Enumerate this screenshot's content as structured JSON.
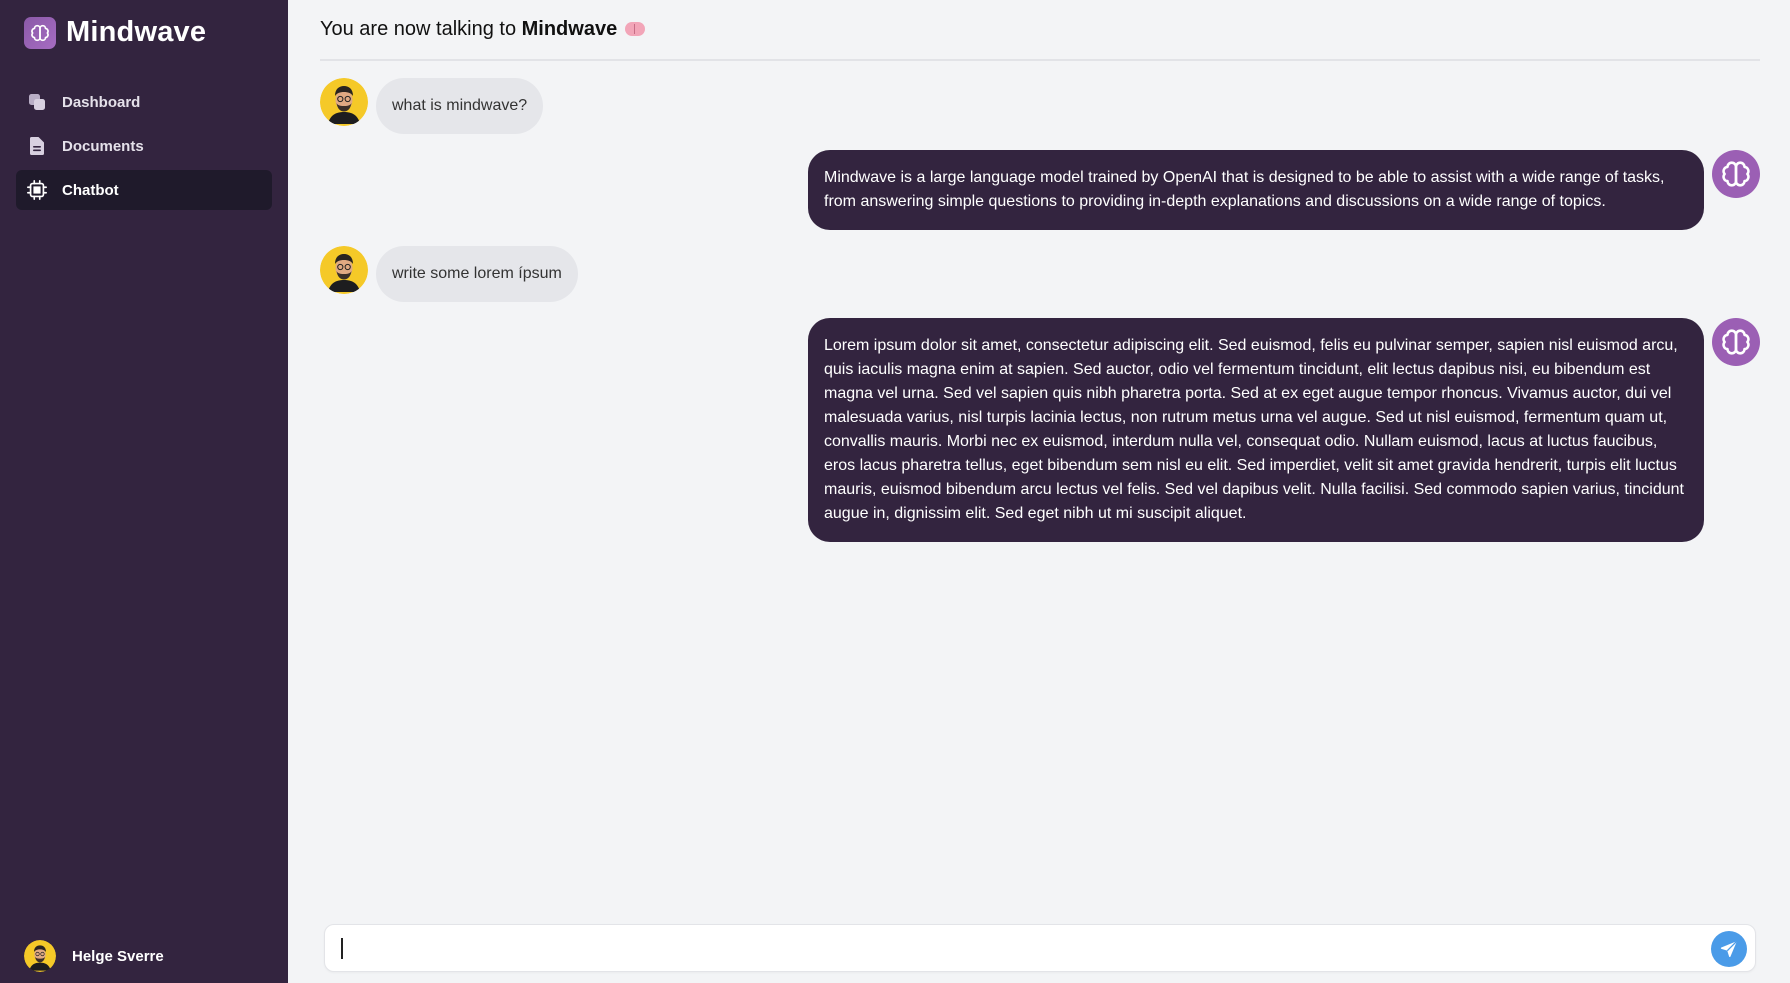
{
  "app": {
    "name": "Mindwave"
  },
  "sidebar": {
    "items": [
      {
        "label": "Dashboard",
        "icon": "dashboard-icon"
      },
      {
        "label": "Documents",
        "icon": "document-icon"
      },
      {
        "label": "Chatbot",
        "icon": "chip-icon",
        "active": true
      }
    ],
    "user": {
      "name": "Helge Sverre"
    }
  },
  "header": {
    "prefix": "You are now talking to ",
    "bot_name": "Mindwave",
    "emoji": "brain-emoji"
  },
  "messages": [
    {
      "role": "user",
      "text": "what is mindwave?"
    },
    {
      "role": "bot",
      "text": "Mindwave is a large language model trained by OpenAI that is designed to be able to assist with a wide range of tasks, from answering simple questions to providing in-depth explanations and discussions on a wide range of topics."
    },
    {
      "role": "user",
      "text": "write some lorem ípsum"
    },
    {
      "role": "bot",
      "text": "Lorem ipsum dolor sit amet, consectetur adipiscing elit. Sed euismod, felis eu pulvinar semper, sapien nisl euismod arcu, quis iaculis magna enim at sapien. Sed auctor, odio vel fermentum tincidunt, elit lectus dapibus nisi, eu bibendum est magna vel urna. Sed vel sapien quis nibh pharetra porta. Sed at ex eget augue tempor rhoncus. Vivamus auctor, dui vel malesuada varius, nisl turpis lacinia lectus, non rutrum metus urna vel augue. Sed ut nisl euismod, fermentum quam ut, convallis mauris. Morbi nec ex euismod, interdum nulla vel, consequat odio. Nullam euismod, lacus at luctus faucibus, eros lacus pharetra tellus, eget bibendum sem nisl eu elit. Sed imperdiet, velit sit amet gravida hendrerit, turpis elit luctus mauris, euismod bibendum arcu lectus vel felis. Sed vel dapibus velit. Nulla facilisi. Sed commodo sapien varius, tincidunt augue in, dignissim elit. Sed eget nibh ut mi suscipit aliquet."
    }
  ],
  "composer": {
    "value": "",
    "placeholder": ""
  },
  "colors": {
    "sidebar_bg": "#33243f",
    "active_item_bg": "#1f1a2b",
    "bot_bubble": "#33243f",
    "user_bubble": "#e5e6ea",
    "bot_avatar": "#9b5fb4",
    "send_button": "#4a9be8"
  }
}
